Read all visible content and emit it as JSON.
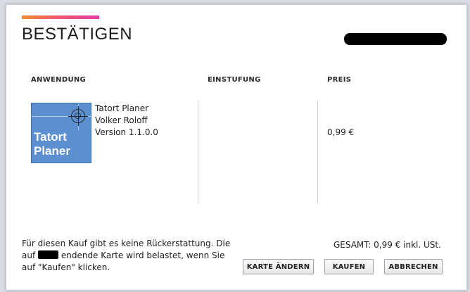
{
  "dialog": {
    "title": "BESTÄTIGEN",
    "accent_colors": [
      "#f28a2e",
      "#ee5a6a",
      "#e23da6"
    ]
  },
  "table": {
    "columns": [
      "ANWENDUNG",
      "EINSTUFUNG",
      "PREIS"
    ],
    "app": {
      "icon_lines": [
        "Tatort",
        "Planer"
      ],
      "name": "Tatort Planer",
      "publisher": "Volker Roloff",
      "version": "Version 1.1.0.0",
      "rating": "",
      "price": "0,99 €"
    }
  },
  "footer": {
    "notice_before": "Für diesen Kauf gibt es keine Rückerstattung. Die auf",
    "notice_after": "endende Karte wird belastet, wenn Sie auf \"Kaufen\" klicken.",
    "total": "GESAMT: 0,99 € inkl. USt."
  },
  "buttons": {
    "change_card": "KARTE ÄNDERN",
    "buy": "KAUFEN",
    "cancel": "ABBRECHEN"
  }
}
